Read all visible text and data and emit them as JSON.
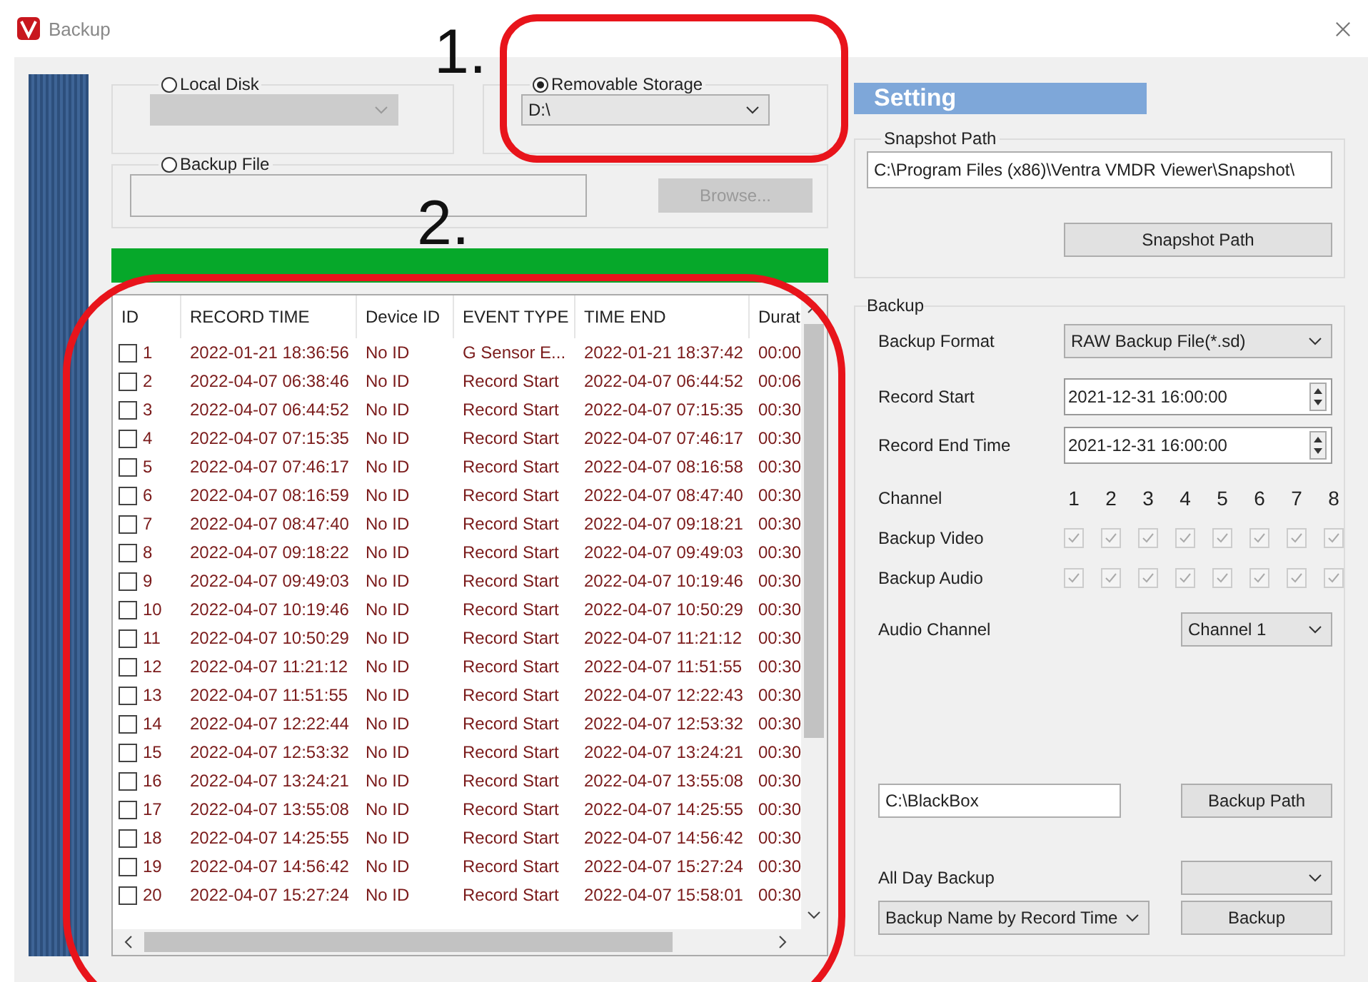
{
  "window": {
    "title": "Backup"
  },
  "annotations": [
    {
      "label": "1."
    },
    {
      "label": "2."
    }
  ],
  "source": {
    "local_disk": {
      "label": "Local Disk",
      "selected": false
    },
    "removable": {
      "label": "Removable Storage",
      "selected": true,
      "value": "D:\\"
    },
    "backup_file": {
      "label": "Backup File",
      "selected": false,
      "browse_button": "Browse..."
    }
  },
  "progress": {
    "level": 1
  },
  "table": {
    "columns": [
      "ID",
      "RECORD TIME",
      "Device ID",
      "EVENT TYPE",
      "TIME END",
      "Durat"
    ],
    "rows": [
      {
        "checked": false,
        "id": "1",
        "record_time": "2022-01-21 18:36:56",
        "device_id": "No ID",
        "event_type": "G Sensor E...",
        "time_end": "2022-01-21 18:37:42",
        "duration": "00:00"
      },
      {
        "checked": false,
        "id": "2",
        "record_time": "2022-04-07 06:38:46",
        "device_id": "No ID",
        "event_type": "Record Start",
        "time_end": "2022-04-07 06:44:52",
        "duration": "00:06"
      },
      {
        "checked": false,
        "id": "3",
        "record_time": "2022-04-07 06:44:52",
        "device_id": "No ID",
        "event_type": "Record Start",
        "time_end": "2022-04-07 07:15:35",
        "duration": "00:30"
      },
      {
        "checked": false,
        "id": "4",
        "record_time": "2022-04-07 07:15:35",
        "device_id": "No ID",
        "event_type": "Record Start",
        "time_end": "2022-04-07 07:46:17",
        "duration": "00:30"
      },
      {
        "checked": false,
        "id": "5",
        "record_time": "2022-04-07 07:46:17",
        "device_id": "No ID",
        "event_type": "Record Start",
        "time_end": "2022-04-07 08:16:58",
        "duration": "00:30"
      },
      {
        "checked": false,
        "id": "6",
        "record_time": "2022-04-07 08:16:59",
        "device_id": "No ID",
        "event_type": "Record Start",
        "time_end": "2022-04-07 08:47:40",
        "duration": "00:30"
      },
      {
        "checked": false,
        "id": "7",
        "record_time": "2022-04-07 08:47:40",
        "device_id": "No ID",
        "event_type": "Record Start",
        "time_end": "2022-04-07 09:18:21",
        "duration": "00:30"
      },
      {
        "checked": false,
        "id": "8",
        "record_time": "2022-04-07 09:18:22",
        "device_id": "No ID",
        "event_type": "Record Start",
        "time_end": "2022-04-07 09:49:03",
        "duration": "00:30"
      },
      {
        "checked": false,
        "id": "9",
        "record_time": "2022-04-07 09:49:03",
        "device_id": "No ID",
        "event_type": "Record Start",
        "time_end": "2022-04-07 10:19:46",
        "duration": "00:30"
      },
      {
        "checked": false,
        "id": "10",
        "record_time": "2022-04-07 10:19:46",
        "device_id": "No ID",
        "event_type": "Record Start",
        "time_end": "2022-04-07 10:50:29",
        "duration": "00:30"
      },
      {
        "checked": false,
        "id": "11",
        "record_time": "2022-04-07 10:50:29",
        "device_id": "No ID",
        "event_type": "Record Start",
        "time_end": "2022-04-07 11:21:12",
        "duration": "00:30"
      },
      {
        "checked": false,
        "id": "12",
        "record_time": "2022-04-07 11:21:12",
        "device_id": "No ID",
        "event_type": "Record Start",
        "time_end": "2022-04-07 11:51:55",
        "duration": "00:30"
      },
      {
        "checked": false,
        "id": "13",
        "record_time": "2022-04-07 11:51:55",
        "device_id": "No ID",
        "event_type": "Record Start",
        "time_end": "2022-04-07 12:22:43",
        "duration": "00:30"
      },
      {
        "checked": false,
        "id": "14",
        "record_time": "2022-04-07 12:22:44",
        "device_id": "No ID",
        "event_type": "Record Start",
        "time_end": "2022-04-07 12:53:32",
        "duration": "00:30"
      },
      {
        "checked": false,
        "id": "15",
        "record_time": "2022-04-07 12:53:32",
        "device_id": "No ID",
        "event_type": "Record Start",
        "time_end": "2022-04-07 13:24:21",
        "duration": "00:30"
      },
      {
        "checked": false,
        "id": "16",
        "record_time": "2022-04-07 13:24:21",
        "device_id": "No ID",
        "event_type": "Record Start",
        "time_end": "2022-04-07 13:55:08",
        "duration": "00:30"
      },
      {
        "checked": false,
        "id": "17",
        "record_time": "2022-04-07 13:55:08",
        "device_id": "No ID",
        "event_type": "Record Start",
        "time_end": "2022-04-07 14:25:55",
        "duration": "00:30"
      },
      {
        "checked": false,
        "id": "18",
        "record_time": "2022-04-07 14:25:55",
        "device_id": "No ID",
        "event_type": "Record Start",
        "time_end": "2022-04-07 14:56:42",
        "duration": "00:30"
      },
      {
        "checked": false,
        "id": "19",
        "record_time": "2022-04-07 14:56:42",
        "device_id": "No ID",
        "event_type": "Record Start",
        "time_end": "2022-04-07 15:27:24",
        "duration": "00:30"
      },
      {
        "checked": false,
        "id": "20",
        "record_time": "2022-04-07 15:27:24",
        "device_id": "No ID",
        "event_type": "Record Start",
        "time_end": "2022-04-07 15:58:01",
        "duration": "00:30"
      }
    ]
  },
  "settings": {
    "title": "Setting",
    "snapshot": {
      "legend": "Snapshot Path",
      "path": "C:\\Program Files (x86)\\Ventra VMDR Viewer\\Snapshot\\",
      "button": "Snapshot Path"
    },
    "backup": {
      "legend": "Backup",
      "format_label": "Backup Format",
      "format_value": "RAW Backup File(*.sd)",
      "record_start_label": "Record Start",
      "record_start_value": "2021-12-31 16:00:00",
      "record_end_label": "Record End Time",
      "record_end_value": "2021-12-31 16:00:00",
      "channel_label": "Channel",
      "channels": [
        "1",
        "2",
        "3",
        "4",
        "5",
        "6",
        "7",
        "8"
      ],
      "video_label": "Backup Video",
      "video": [
        {
          "checked": true,
          "disabled": true
        },
        {
          "checked": true,
          "disabled": true
        },
        {
          "checked": true,
          "disabled": true
        },
        {
          "checked": true,
          "disabled": true
        },
        {
          "checked": true,
          "disabled": true
        },
        {
          "checked": true,
          "disabled": true
        },
        {
          "checked": true,
          "disabled": true
        },
        {
          "checked": true,
          "disabled": true
        }
      ],
      "audio_label": "Backup Audio",
      "audio": [
        {
          "checked": true,
          "disabled": true
        },
        {
          "checked": true,
          "disabled": true
        },
        {
          "checked": true,
          "disabled": true
        },
        {
          "checked": true,
          "disabled": true
        },
        {
          "checked": true,
          "disabled": true
        },
        {
          "checked": true,
          "disabled": true
        },
        {
          "checked": true,
          "disabled": true
        },
        {
          "checked": true,
          "disabled": true
        }
      ],
      "audio_channel_label": "Audio Channel",
      "audio_channel_value": "Channel 1",
      "path_value": "C:\\BlackBox",
      "path_button": "Backup Path",
      "all_day_label": "All Day Backup",
      "name_mode": "Backup Name by Record Time",
      "backup_button": "Backup"
    }
  }
}
